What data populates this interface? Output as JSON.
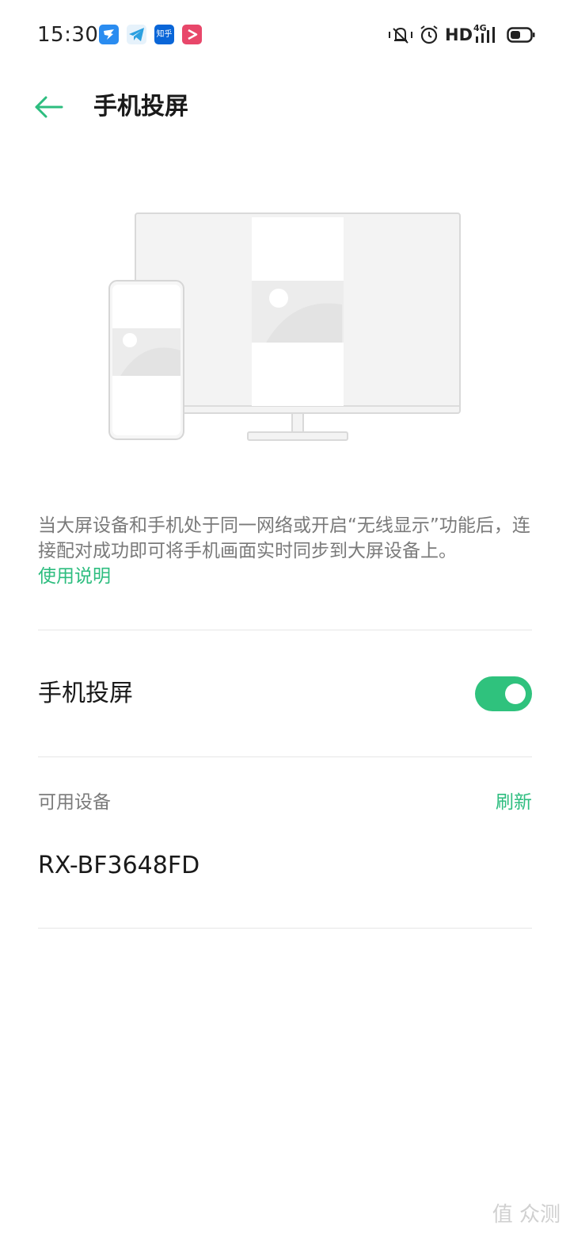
{
  "status_bar": {
    "time": "15:30",
    "notification_apps": [
      "dingtalk-icon",
      "telegram-icon",
      "zhihu-icon",
      "video-app-icon"
    ],
    "zhihu_label": "知乎",
    "network_label": "HD",
    "network_type": "4G",
    "icons": [
      "mute-vibrate-icon",
      "alarm-icon",
      "signal-icon",
      "battery-icon"
    ]
  },
  "app_bar": {
    "title": "手机投屏"
  },
  "description": {
    "text": "当大屏设备和手机处于同一网络或开启“无线显示”功能后，连接配对成功即可将手机画面实时同步到大屏设备上。",
    "help_link": "使用说明"
  },
  "screen_cast": {
    "label": "手机投屏",
    "enabled": true
  },
  "devices": {
    "section_title": "可用设备",
    "refresh_label": "刷新",
    "items": [
      {
        "name": "RX-BF3648FD"
      }
    ]
  },
  "watermark": "值 众测",
  "colors": {
    "accent": "#2fc27d",
    "link": "#2dbd7f",
    "secondary_text": "#7a7a7a"
  }
}
